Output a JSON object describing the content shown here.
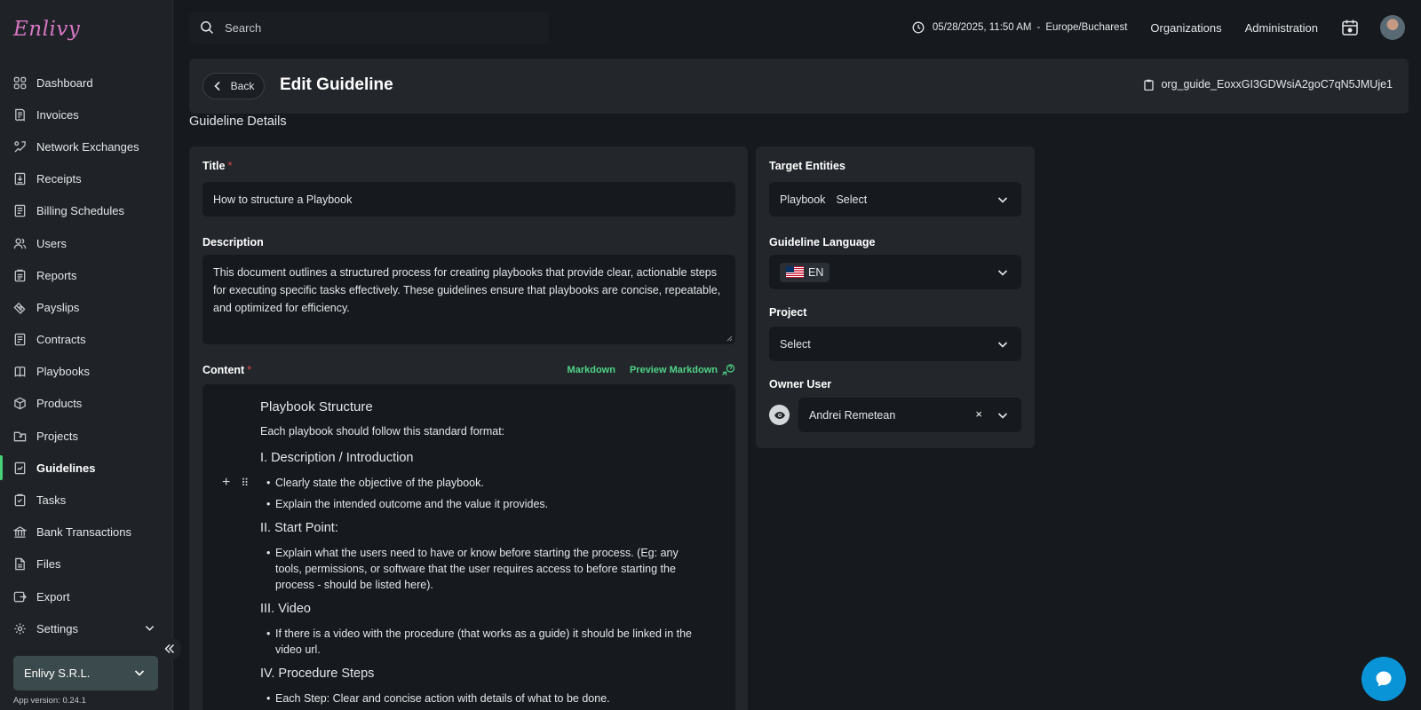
{
  "app": {
    "logo": "Enlivy"
  },
  "sidebar": {
    "items": [
      {
        "label": "Dashboard",
        "icon": "dashboard-icon"
      },
      {
        "label": "Invoices",
        "icon": "invoice-icon"
      },
      {
        "label": "Network Exchanges",
        "icon": "network-icon"
      },
      {
        "label": "Receipts",
        "icon": "receipt-icon"
      },
      {
        "label": "Billing Schedules",
        "icon": "billing-icon"
      },
      {
        "label": "Users",
        "icon": "users-icon"
      },
      {
        "label": "Reports",
        "icon": "reports-icon"
      },
      {
        "label": "Payslips",
        "icon": "payslip-icon"
      },
      {
        "label": "Contracts",
        "icon": "contract-icon"
      },
      {
        "label": "Playbooks",
        "icon": "playbook-icon"
      },
      {
        "label": "Products",
        "icon": "product-icon"
      },
      {
        "label": "Projects",
        "icon": "project-icon"
      },
      {
        "label": "Guidelines",
        "icon": "guideline-icon",
        "active": true
      },
      {
        "label": "Tasks",
        "icon": "task-icon"
      },
      {
        "label": "Bank Transactions",
        "icon": "bank-icon"
      },
      {
        "label": "Files",
        "icon": "file-icon"
      },
      {
        "label": "Export",
        "icon": "export-icon"
      },
      {
        "label": "Settings",
        "icon": "settings-icon"
      }
    ],
    "organization": "Enlivy S.R.L.",
    "app_version": "App version: 0.24.1"
  },
  "topbar": {
    "search_placeholder": "Search",
    "datetime": "05/28/2025, 11:50 AM",
    "separator": "-",
    "timezone": "Europe/Bucharest",
    "organizations": "Organizations",
    "administration": "Administration"
  },
  "header": {
    "back_label": "Back",
    "title": "Edit Guideline",
    "guide_id": "org_guide_EoxxGI3GDWsiA2goC7qN5JMUje1"
  },
  "section_title": "Guideline Details",
  "form": {
    "title_label": "Title",
    "title_value": "How to structure a Playbook",
    "description_label": "Description",
    "description_value": "This document outlines a structured process for creating playbooks that provide clear, actionable steps for executing specific tasks effectively. These guidelines ensure that playbooks are concise, repeatable, and optimized for efficiency.",
    "content_label": "Content",
    "required_mark": "*",
    "markdown_link": "Markdown",
    "preview_link": "Preview Markdown",
    "content": {
      "h1": "Playbook Structure",
      "intro": "Each playbook should follow this standard format:",
      "s1": "I. Description / Introduction",
      "s1_li1": "Clearly state the objective of the playbook.",
      "s1_li2": "Explain the intended outcome and the value it provides.",
      "s2": "II. Start Point:",
      "s2_li1": "Explain what the users need to have or know before starting the process. (Eg: any tools, permissions, or software that the user requires access to before starting the process - should be listed here).",
      "s3": "III. Video",
      "s3_li1": "If there is a video with the procedure (that works as a guide) it should be linked in the video url.",
      "s4": "IV. Procedure Steps",
      "s4_li1": "Each Step: Clear and concise action with details of what to be done."
    }
  },
  "side": {
    "target_label": "Target Entities",
    "target_entity": "Playbook",
    "target_select": "Select",
    "language_label": "Guideline Language",
    "language_value": "EN",
    "project_label": "Project",
    "project_value": "Select",
    "owner_label": "Owner User",
    "owner_value": "Andrei Remetean",
    "clear_glyph": "×"
  },
  "colors": {
    "accent_green": "#46d17a",
    "link_green": "#4fd486",
    "required_red": "#e0474c",
    "chat_blue": "#0a94d8",
    "logo_pink": "#d777c4"
  }
}
